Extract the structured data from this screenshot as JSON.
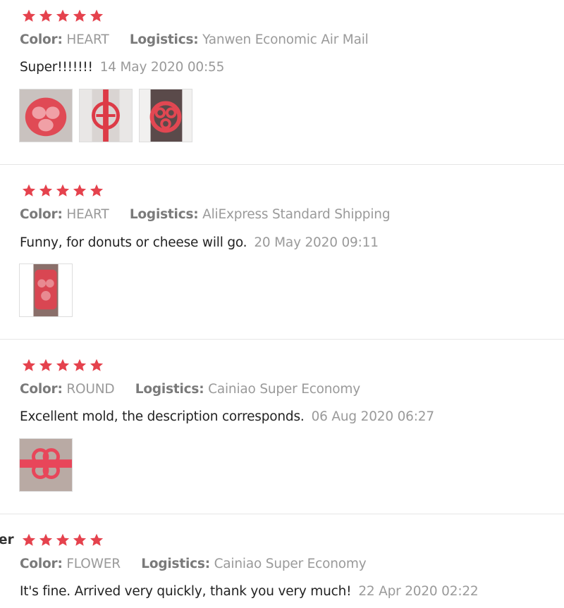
{
  "colors": {
    "star": "#e5424d",
    "muted": "#9a9a9a"
  },
  "labels": {
    "color": "Color:",
    "logistics": "Logistics:"
  },
  "reviews": [
    {
      "rating": 5,
      "color": "HEART",
      "logistics": "Yanwen Economic Air Mail",
      "text": "Super!!!!!!!",
      "date": "14 May 2020 00:55",
      "photos": [
        "photo-heart-mold-top",
        "photo-heart-mold-strap",
        "photo-heart-mold-dark"
      ]
    },
    {
      "rating": 5,
      "color": "HEART",
      "logistics": "AliExpress Standard Shipping",
      "text": "Funny, for donuts or cheese will go.",
      "date": "20 May 2020 09:11",
      "photos": [
        "photo-heart-mold-package"
      ]
    },
    {
      "rating": 5,
      "color": "ROUND",
      "logistics": "Cainiao Super Economy",
      "text": "Excellent mold, the description corresponds.",
      "date": "06 Aug 2020 06:27",
      "photos": [
        "photo-round-mold"
      ]
    },
    {
      "rating": 5,
      "color": "FLOWER",
      "logistics": "Cainiao Super Economy",
      "text": "It's fine. Arrived very quickly, thank you very much!",
      "date": "22 Apr 2020 02:22",
      "photos": [],
      "cut_off_username_tail": "er"
    }
  ]
}
